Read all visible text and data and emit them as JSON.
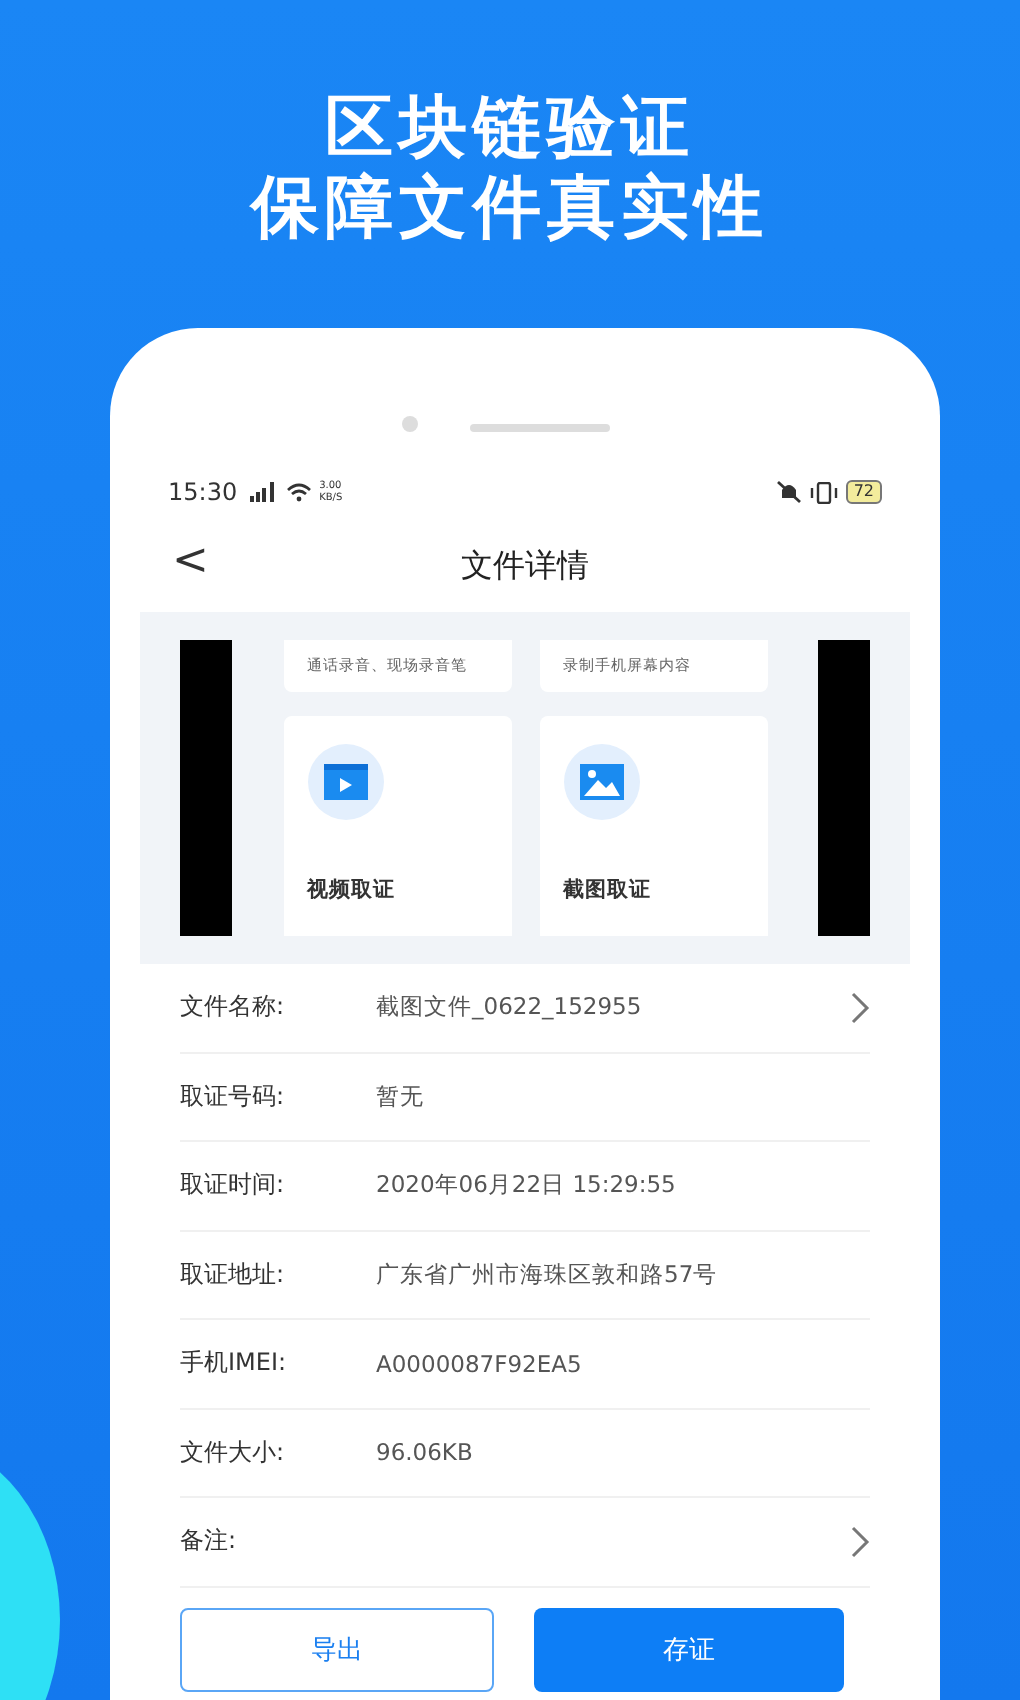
{
  "headline": [
    "区块链验证",
    "保障文件真实性"
  ],
  "status_bar": {
    "time": "15:30",
    "net_speed": [
      "3.00",
      "KB/S"
    ],
    "battery": "72"
  },
  "nav": {
    "back": "<",
    "title": "文件详情"
  },
  "preview": {
    "top_cards": [
      "通话录音、现场录音笔",
      "录制手机屏幕内容"
    ],
    "cards": [
      {
        "kind": "video",
        "title": "视频取证"
      },
      {
        "kind": "image",
        "title": "截图取证"
      }
    ]
  },
  "rows": [
    {
      "label": "文件名称:",
      "value": "截图文件_0622_152955",
      "chevron": true
    },
    {
      "label": "取证号码:",
      "value": "暂无",
      "chevron": false
    },
    {
      "label": "取证时间:",
      "value": "2020年06月22日 15:29:55",
      "chevron": false
    },
    {
      "label": "取证地址:",
      "value": "广东省广州市海珠区敦和路57号",
      "chevron": false
    },
    {
      "label": "手机IMEI:",
      "value": "A0000087F92EA5",
      "chevron": false
    },
    {
      "label": "文件大小:",
      "value": "96.06KB",
      "chevron": false
    },
    {
      "label": "备注:",
      "value": null,
      "chevron": true
    }
  ],
  "buttons": [
    {
      "kind": "outline",
      "label": "导出"
    },
    {
      "kind": "primary",
      "label": "存证"
    }
  ]
}
